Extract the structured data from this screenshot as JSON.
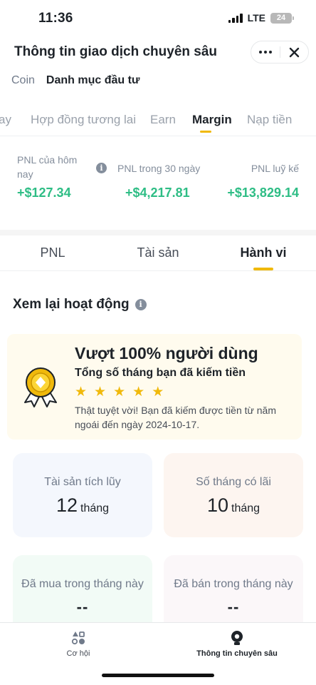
{
  "status": {
    "time": "11:36",
    "network": "LTE",
    "battery": "24"
  },
  "header": {
    "title": "Thông tin giao dịch chuyên sâu"
  },
  "top_tabs": [
    {
      "label": "Coin",
      "active": false
    },
    {
      "label": "Danh mục đầu tư",
      "active": true
    }
  ],
  "sub_tabs": [
    {
      "label": "ay",
      "active": false
    },
    {
      "label": "Hợp đồng tương lai",
      "active": false
    },
    {
      "label": "Earn",
      "active": false
    },
    {
      "label": "Margin",
      "active": true
    },
    {
      "label": "Nạp tiền",
      "active": false
    }
  ],
  "pnl": {
    "today_label": "PNL của hôm nay",
    "today_value": "+$127.34",
    "d30_label": "PNL trong 30 ngày",
    "d30_value": "+$4,217.81",
    "cumulative_label": "PNL luỹ kế",
    "cumulative_value": "+$13,829.14"
  },
  "segment_tabs": [
    {
      "label": "PNL",
      "active": false
    },
    {
      "label": "Tài sản",
      "active": false
    },
    {
      "label": "Hành vi",
      "active": true
    }
  ],
  "review": {
    "title": "Xem lại hoạt động"
  },
  "achievement": {
    "title": "Vượt 100% người dùng",
    "subtitle": "Tổng số tháng bạn đã kiếm tiền",
    "stars": 5,
    "description": "Thật tuyệt vời! Bạn đã kiếm được tiền từ năm ngoái đến ngày 2024-10-17."
  },
  "stats": {
    "accumulated": {
      "label": "Tài sản tích lũy",
      "value": "12",
      "unit": "tháng"
    },
    "profitable": {
      "label": "Số tháng có lãi",
      "value": "10",
      "unit": "tháng"
    },
    "bought": {
      "label": "Đã mua trong tháng này",
      "value": "--"
    },
    "sold": {
      "label": "Đã bán trong tháng này",
      "value": "--"
    }
  },
  "bottom_nav": [
    {
      "label": "Cơ hội",
      "active": false
    },
    {
      "label": "Thông tin chuyên sâu",
      "active": true
    }
  ],
  "colors": {
    "accent": "#f0b90b",
    "positive": "#2ebd85",
    "achievement_bg": "#fffbee"
  }
}
